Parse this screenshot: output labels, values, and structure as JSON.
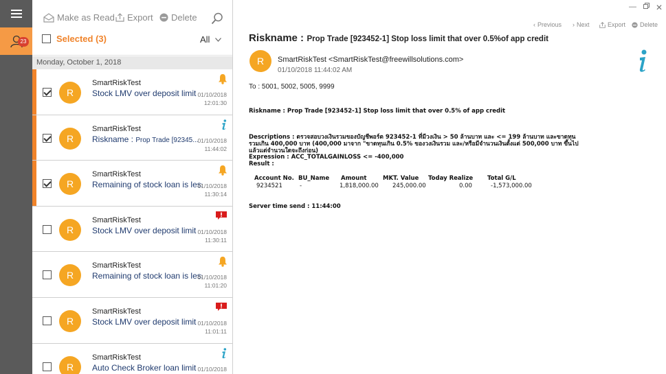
{
  "rail": {
    "badge_count": "23",
    "colors": {
      "rail_bg": "#5a5a5a",
      "active_tab": "#f59a45",
      "badge": "#d9402f"
    }
  },
  "toolbar": {
    "make_as_read": "Make as Read",
    "export": "Export",
    "delete": "Delete",
    "selected_label": "Selected (3)",
    "filter_value": "All"
  },
  "list": {
    "date_header": "Monday, October 1, 2018",
    "items": [
      {
        "checked": true,
        "flag": "bell-icon",
        "sender": "SmartRiskTest",
        "subject": "Stock LMV over deposit limit",
        "date": "01/10/2018",
        "time": "12:01:30"
      },
      {
        "checked": true,
        "flag": "info-icon",
        "sender": "SmartRiskTest",
        "subject_prefix": "Riskname : ",
        "subject": "Prop Trade [92345...",
        "date": "01/10/2018",
        "time": "11:44:02"
      },
      {
        "checked": true,
        "flag": "bell-icon",
        "sender": "SmartRiskTest",
        "subject": "Remaining of stock loan is less",
        "date": "01/10/2018",
        "time": "11:30:14"
      },
      {
        "checked": false,
        "flag": "alert-icon",
        "sender": "SmartRiskTest",
        "subject": "Stock LMV over deposit limit",
        "date": "01/10/2018",
        "time": "11:30:11"
      },
      {
        "checked": false,
        "flag": "bell-icon",
        "sender": "SmartRiskTest",
        "subject": "Remaining of stock loan is less",
        "date": "01/10/2018",
        "time": "11:01:20"
      },
      {
        "checked": false,
        "flag": "alert-icon",
        "sender": "SmartRiskTest",
        "subject": "Stock LMV over deposit limit",
        "date": "01/10/2018",
        "time": "11:01:11"
      },
      {
        "checked": false,
        "flag": "info-icon",
        "sender": "SmartRiskTest",
        "subject": "Auto Check Broker loan limit",
        "date": "01/10/2018",
        "time": ""
      }
    ]
  },
  "detail": {
    "nav": {
      "previous": "Previous",
      "next": "Next",
      "export": "Export",
      "delete": "Delete"
    },
    "title_label": "Riskname :",
    "title_value": "Prop Trade [923452-1] Stop loss limit that over 0.5%of app credit",
    "avatar_letter": "R",
    "from": "SmartRiskTest <SmartRiskTest@freewillsolutions.com>",
    "datetime": "01/10/2018 11:44:02 AM",
    "to": "To : 5001, 5002, 5005, 9999",
    "riskname_line": "Riskname : Prop Trade [923452-1] Stop loss limit that over 0.5% of app credit",
    "description": "Descriptions : ตรวจสอบวงเงินรวมของบัญชีพอร์ต 923452-1 ที่มีวงเงิน > 50 ล้านบาท และ <= 199 ล้านบาท และขาดทุนรวมเกิน 400,000 บาท (400,000 มาจาก \"ขาดทุนเกิน 0.5% ของวงเงินรวม และ/หรือมีจำนวนเงินตั้งแต่ 500,000 บาท ขึ้นไป แล้วแต่จำนวนใดจะถึงก่อน)",
    "expression": "Expression : ACC_TOTALGAINLOSS <= -400,000",
    "result_label": "Result :",
    "table": {
      "headers": [
        "Account No.",
        "BU_Name",
        "Amount",
        "MKT. Value",
        "Today Realize",
        "Total G/L"
      ],
      "row": [
        "9234521",
        "-",
        "1,818,000.00",
        "245,000.00",
        "0.00",
        "-1,573,000.00"
      ]
    },
    "server_time": "Server time send : 11:44:00"
  }
}
